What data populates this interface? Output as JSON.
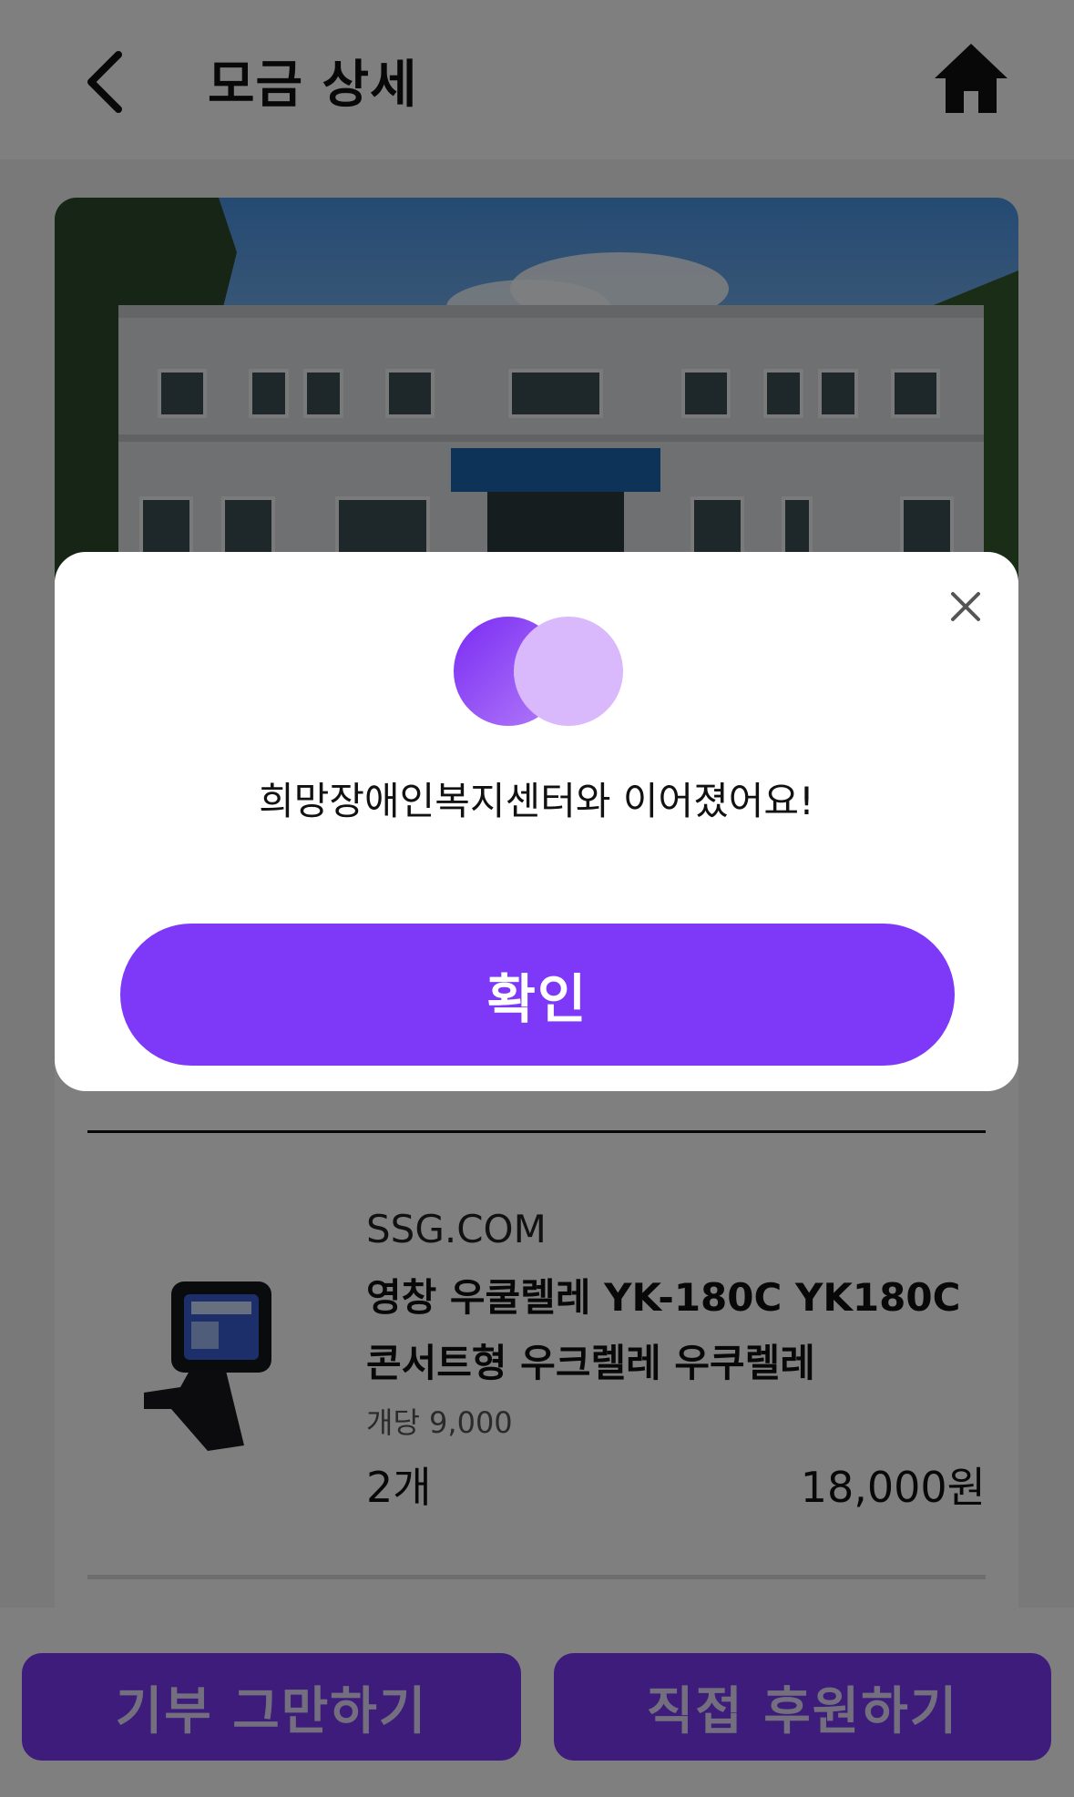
{
  "header": {
    "title": "모금 상세"
  },
  "product": {
    "store": "SSG.COM",
    "name": "영창 우쿨렐레 YK-180C YK180C 콘서트형 우크렐레 우쿠렐레",
    "unit_price": "개당 9,000",
    "quantity": "2개",
    "total": "18,000원"
  },
  "bottom": {
    "stop_label": "기부 그만하기",
    "direct_label": "직접 후원하기"
  },
  "modal": {
    "message": "희망장애인복지센터와 이어졌어요!",
    "confirm_label": "확인"
  },
  "colors": {
    "accent": "#7d39f7",
    "accent_light": "#d9b8fb",
    "overlay": "rgba(0,0,0,0.5)"
  }
}
